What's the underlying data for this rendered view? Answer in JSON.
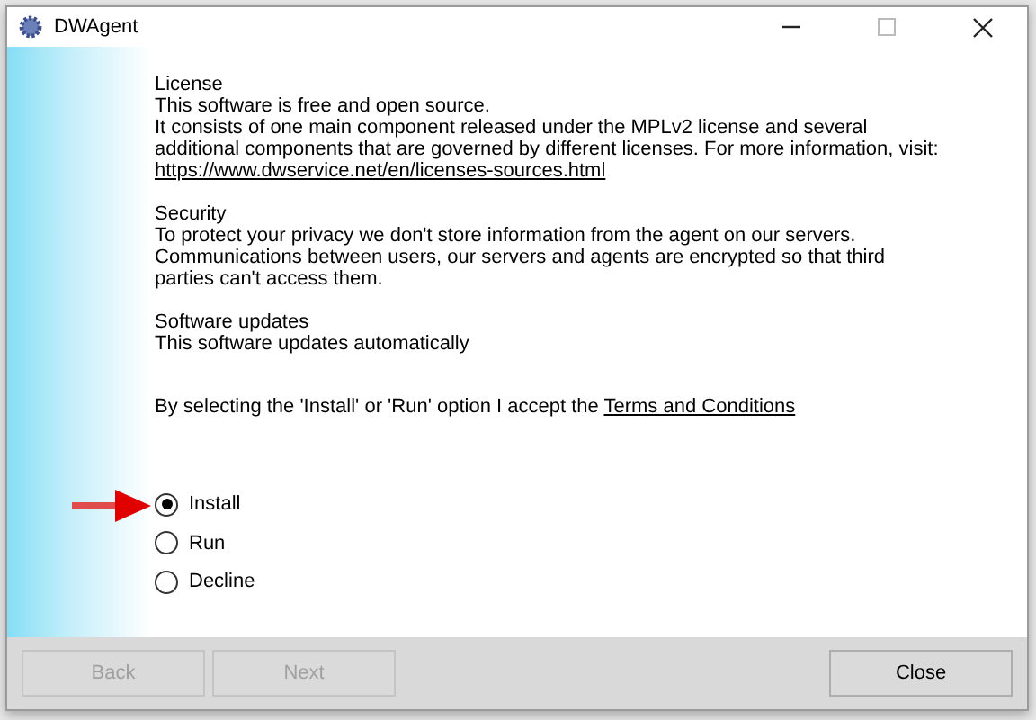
{
  "window": {
    "title": "DWAgent"
  },
  "sections": [
    {
      "heading": "License",
      "lines": [
        "This software is free and open source.",
        "It consists of one main component released under the MPLv2 license and several additional components that are governed by different licenses. For more information, visit:"
      ],
      "link": "https://www.dwservice.net/en/licenses-sources.html"
    },
    {
      "heading": "Security",
      "lines": [
        "To protect your privacy we don't store information from the agent on our servers. Communications between users, our servers and agents are encrypted so that third parties can't access them."
      ]
    },
    {
      "heading": "Software updates",
      "lines": [
        "This software updates automatically"
      ]
    }
  ],
  "acceptance": {
    "text": "By selecting the 'Install' or 'Run' option I accept the",
    "link": "Terms and Conditions"
  },
  "options": [
    {
      "label": "Install",
      "selected": true
    },
    {
      "label": "Run",
      "selected": false
    },
    {
      "label": "Decline",
      "selected": false
    }
  ],
  "buttons": [
    {
      "label": "Back",
      "disabled": true
    },
    {
      "label": "Next",
      "disabled": true
    },
    {
      "label": "Close",
      "disabled": false
    }
  ]
}
